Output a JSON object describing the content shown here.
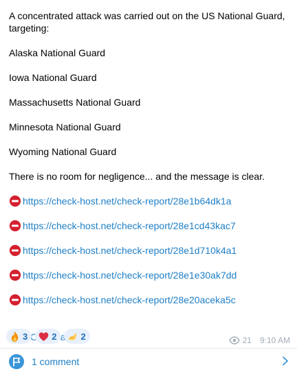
{
  "message": {
    "intro": "A concentrated attack was carried out on the US National Guard, targeting:",
    "targets": [
      "Alaska National Guard",
      "Iowa National Guard",
      "Massachusetts National Guard",
      "Minnesota National Guard",
      "Wyoming National Guard"
    ],
    "closing": "There is no room for negligence... and the message is clear.",
    "links": [
      "https://check-host.net/check-report/28e1b64dk1a",
      "https://check-host.net/check-report/28e1cd43kac7",
      "https://check-host.net/check-report/28e1d710k4a1",
      "https://check-host.net/check-report/28e1e30ak7dd",
      "https://check-host.net/check-report/28e20aceka5c"
    ],
    "link_icon": "no-entry-icon",
    "hashtag": "#Op_Usa"
  },
  "reactions": [
    {
      "icon": "fire-emoji-icon",
      "count": "3"
    },
    {
      "icon": "heart-emoji-icon",
      "count": "2"
    },
    {
      "icon": "flexed-biceps-emoji-icon",
      "count": "2"
    }
  ],
  "meta": {
    "views": "21",
    "time": "9:10 AM"
  },
  "comments": {
    "label": "1 comment"
  },
  "colors": {
    "link": "#1f7fc5",
    "reaction_bg": "#e8f0fb",
    "meta": "#a3adb8"
  }
}
